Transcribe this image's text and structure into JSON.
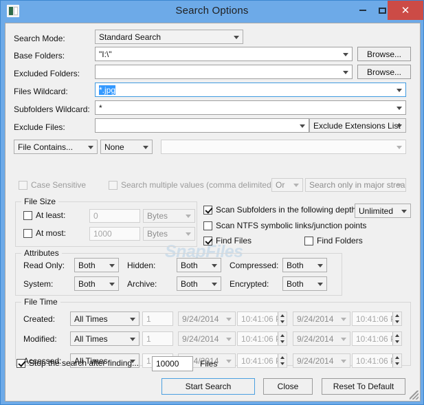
{
  "window": {
    "title": "Search Options",
    "icon": "app-icon",
    "minimize_label": "–",
    "maximize_label": "□",
    "close_label": "✕"
  },
  "watermark": "SnapFiles",
  "form": {
    "search_mode": {
      "label": "Search Mode:",
      "value": "Standard Search"
    },
    "base_folders": {
      "label": "Base Folders:",
      "value": "\"I:\\\"",
      "browse_label": "Browse..."
    },
    "excluded_folders": {
      "label": "Excluded Folders:",
      "value": "",
      "browse_label": "Browse..."
    },
    "files_wildcard": {
      "label": "Files Wildcard:",
      "value": "*.jpg"
    },
    "subfolders_wildcard": {
      "label": "Subfolders Wildcard:",
      "value": "*"
    },
    "exclude_files": {
      "label": "Exclude Files:",
      "value": "",
      "extensions_list": "Exclude Extensions List"
    },
    "contains": {
      "mode": "File Contains...",
      "type": "None",
      "text": "",
      "case_sensitive": "Case Sensitive",
      "multiple_values": "Search multiple values (comma delimited)",
      "operator": "Or",
      "stream_scope": "Search only in major strea"
    }
  },
  "file_size": {
    "title": "File Size",
    "at_least": {
      "label": "At least:",
      "value": "0",
      "unit": "Bytes"
    },
    "at_most": {
      "label": "At most:",
      "value": "1000",
      "unit": "Bytes"
    }
  },
  "scan": {
    "subfolders_depth": {
      "label": "Scan Subfolders in the following depth:",
      "depth": "Unlimited"
    },
    "ntfs_links": "Scan NTFS symbolic links/junction points",
    "find_files": "Find Files",
    "find_folders": "Find Folders"
  },
  "attributes": {
    "title": "Attributes",
    "rows": [
      {
        "label": "Read Only:",
        "value": "Both"
      },
      {
        "label": "Hidden:",
        "value": "Both"
      },
      {
        "label": "Compressed:",
        "value": "Both"
      },
      {
        "label": "System:",
        "value": "Both"
      },
      {
        "label": "Archive:",
        "value": "Both"
      },
      {
        "label": "Encrypted:",
        "value": "Both"
      }
    ]
  },
  "file_time": {
    "title": "File Time",
    "rows": [
      {
        "label": "Created:",
        "mode": "All Times",
        "amount": "1",
        "from_date": "9/24/2014",
        "from_time": "10:41:06 P",
        "to_date": "9/24/2014",
        "to_time": "10:41:06 P"
      },
      {
        "label": "Modified:",
        "mode": "All Times",
        "amount": "1",
        "from_date": "9/24/2014",
        "from_time": "10:41:06 P",
        "to_date": "9/24/2014",
        "to_time": "10:41:06 P"
      },
      {
        "label": "Accessed:",
        "mode": "All Times",
        "amount": "1",
        "from_date": "9/24/2014",
        "from_time": "10:41:06 P",
        "to_date": "9/24/2014",
        "to_time": "10:41:06 P"
      }
    ]
  },
  "footer": {
    "stop_label": "Stop the search after finding...",
    "stop_value": "10000",
    "files_label": "Files",
    "start_button": "Start Search",
    "close_button": "Close",
    "reset_button": "Reset To Default"
  },
  "colors": {
    "titlebar": "#6daae8",
    "close_button": "#cc4b46",
    "client": "#f0f0f0",
    "selection": "#3399ff",
    "focus_border": "#3f9ae0",
    "watermark": "#cfdeea"
  }
}
